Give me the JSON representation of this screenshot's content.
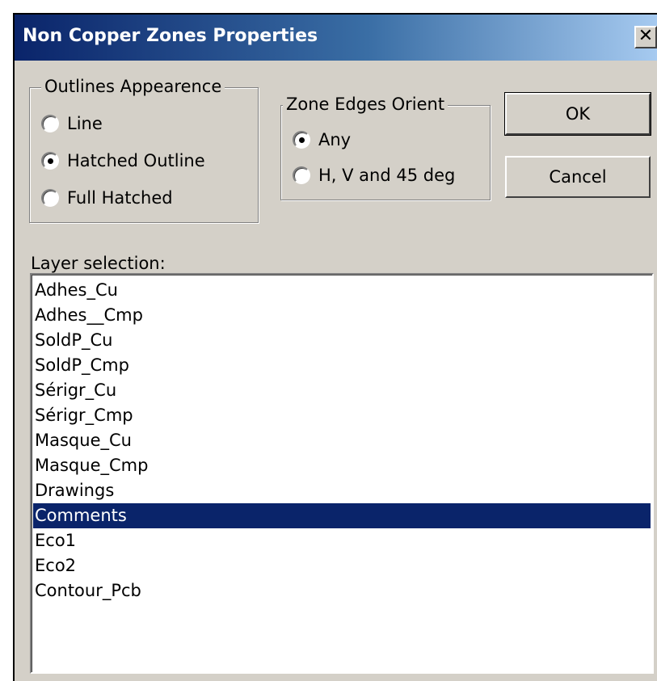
{
  "window": {
    "title": "Non Copper Zones Properties",
    "close_glyph": "✕",
    "title_gradient": [
      "#0a246a",
      "#a6caf0"
    ],
    "face_color": "#d4d0c8"
  },
  "outlines_group": {
    "label": "Outlines Appearence",
    "options": [
      {
        "label": "Line",
        "selected": false
      },
      {
        "label": "Hatched Outline",
        "selected": true
      },
      {
        "label": "Full Hatched",
        "selected": false
      }
    ]
  },
  "orient_group": {
    "label": "Zone Edges Orient",
    "options": [
      {
        "label": "Any",
        "selected": true
      },
      {
        "label": "H, V and 45 deg",
        "selected": false
      }
    ]
  },
  "buttons": {
    "ok": "OK",
    "cancel": "Cancel"
  },
  "layer_selection": {
    "label": "Layer selection:",
    "items": [
      "Adhes_Cu",
      "Adhes__Cmp",
      "SoldP_Cu",
      "SoldP_Cmp",
      "Sérigr_Cu",
      "Sérigr_Cmp",
      "Masque_Cu",
      "Masque_Cmp",
      "Drawings",
      "Comments",
      "Eco1",
      "Eco2",
      "Contour_Pcb"
    ],
    "selected_item": "Comments",
    "selection_color": "#0a246a"
  }
}
